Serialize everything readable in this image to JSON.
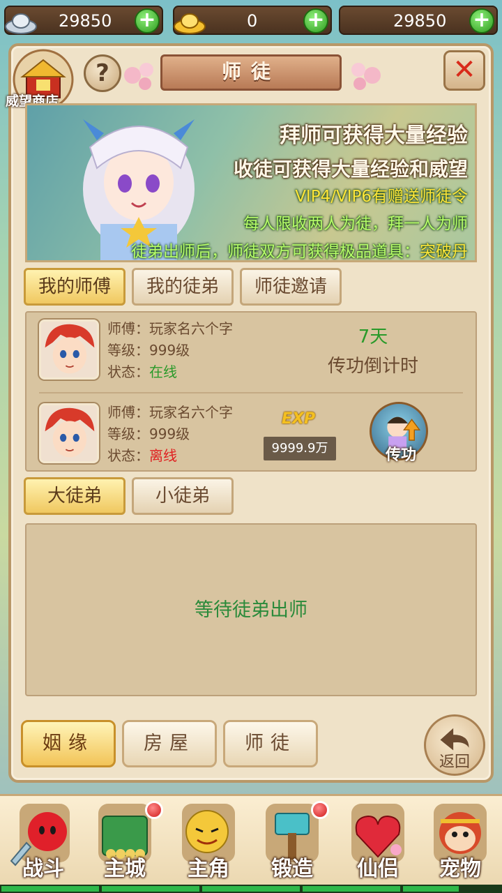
{
  "currency": {
    "silver": "29850",
    "gold": "0",
    "third": "29850"
  },
  "header": {
    "title": "师徒",
    "shop_label": "威望商店",
    "help": "?",
    "close": "✕"
  },
  "banner": {
    "line1": "拜师可获得大量经验",
    "line2": "收徒可获得大量经验和威望",
    "line3": "VIP4/VIP6有赠送师徒令",
    "line4": "每人限收两人为徒，拜一人为师",
    "line5_prefix": "徒弟出师后，师徒双方可获得极品道具：",
    "line5_item": "突破丹"
  },
  "tabs": [
    {
      "label": "我的师傅"
    },
    {
      "label": "我的徒弟"
    },
    {
      "label": "师徒邀请"
    }
  ],
  "masters": [
    {
      "name_key": "师傅：",
      "name": "玩家名六个字",
      "level_key": "等级：",
      "level": "999级",
      "status_key": "状态：",
      "status": "在线"
    },
    {
      "name_key": "师傅：",
      "name": "玩家名六个字",
      "level_key": "等级：",
      "level": "999级",
      "status_key": "状态：",
      "status": "离线"
    }
  ],
  "countdown": {
    "days": "7天",
    "label": "传功倒计时"
  },
  "exp": {
    "icon_text": "EXP",
    "value": "9999.9万"
  },
  "chuangong_label": "传功",
  "disciple_tabs": [
    {
      "label": "大徒弟"
    },
    {
      "label": "小徒弟"
    }
  ],
  "disciple_empty": "等待徒弟出师",
  "panel_buttons": [
    {
      "label": "姻缘"
    },
    {
      "label": "房屋"
    },
    {
      "label": "师徒"
    }
  ],
  "back_label": "返回",
  "nav": [
    {
      "label": "战斗",
      "icon": "red-ninja-icon"
    },
    {
      "label": "主城",
      "icon": "city-gate-icon"
    },
    {
      "label": "主角",
      "icon": "hero-face-icon"
    },
    {
      "label": "锻造",
      "icon": "hammer-icon"
    },
    {
      "label": "仙侣",
      "icon": "heart-icon"
    },
    {
      "label": "宠物",
      "icon": "monkey-icon"
    }
  ],
  "colors": {
    "online": "#2a9a2a",
    "offline": "#e02020",
    "accent_gold": "#f0c860"
  }
}
